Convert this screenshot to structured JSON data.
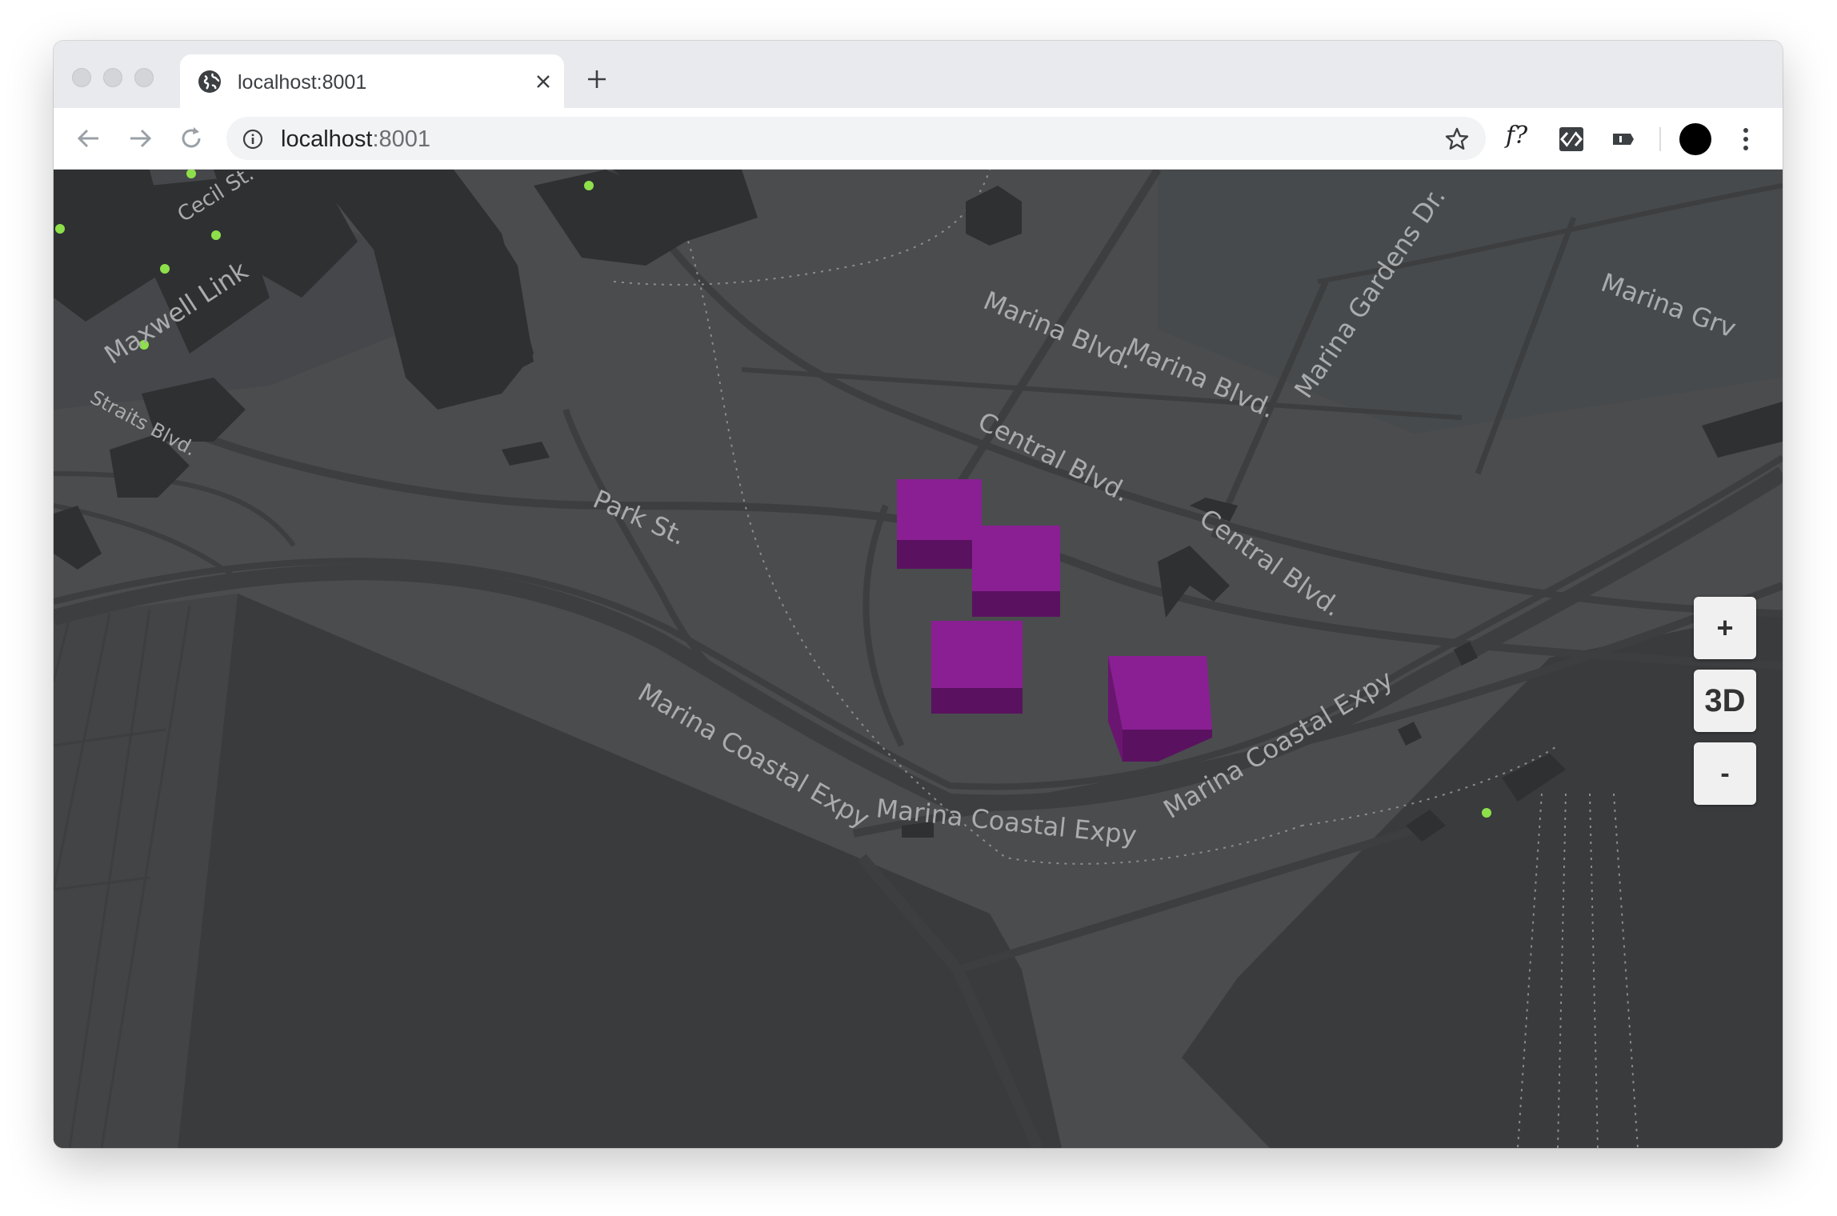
{
  "browser": {
    "tab": {
      "title": "localhost:8001",
      "favicon": "globe-icon"
    },
    "address": {
      "host": "localhost",
      "port": ":8001"
    },
    "extensions": {
      "formula_label": "f?"
    }
  },
  "map": {
    "labels": {
      "cecil": "Cecil St.",
      "maxwell": "Maxwell Link",
      "straits": "Straits Blvd.",
      "park": "Park St.",
      "marina_blvd_1": "Marina Blvd.",
      "marina_blvd_2": "Marina Blvd.",
      "marina_gardens": "Marina Gardens Dr.",
      "marina_grv": "Marina Grv",
      "central_1": "Central Blvd.",
      "central_2": "Central Blvd.",
      "coastal_1": "Marina Coastal Expy",
      "coastal_2": "Marina Coastal Expy",
      "coastal_3": "Marina Coastal Expy"
    },
    "colors": {
      "background": "#4a4c4e",
      "water": "#3a3b3d",
      "road": "#3c3e40",
      "building": "#2e3032",
      "highlight_top": "#8a1f93",
      "highlight_side": "#5a1260",
      "point": "#8ee04a"
    },
    "controls": {
      "zoom_in": "+",
      "toggle_3d": "3D",
      "zoom_out": "-"
    }
  }
}
